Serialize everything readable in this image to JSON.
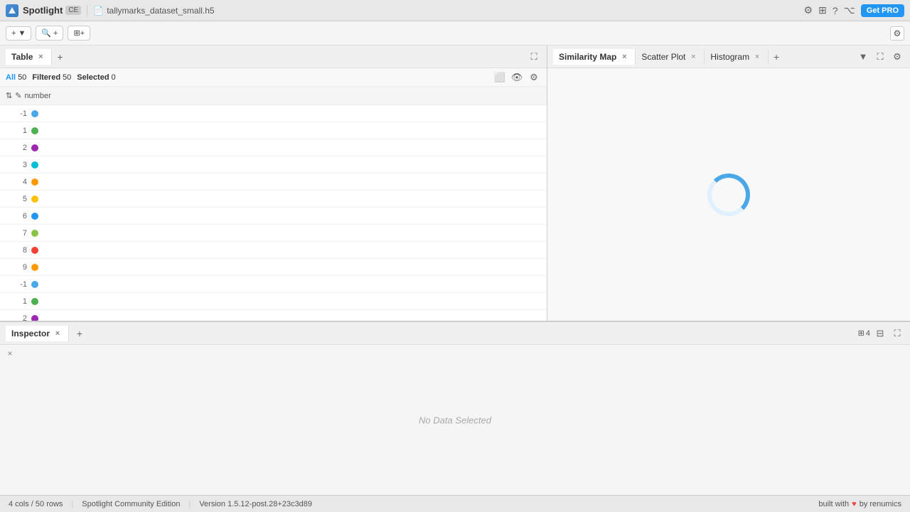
{
  "titlebar": {
    "title": "Spotlight",
    "ce_badge": "CE",
    "file_icon": "📄",
    "filename": "tallymarks_dataset_small.h5",
    "get_pro": "Get PRO"
  },
  "toolbar": {
    "add_filter_label": "+ ▼",
    "search_label": "🔍+",
    "add_col_label": "⊞+"
  },
  "table_panel": {
    "tab_label": "Table",
    "tab_close": "×",
    "add_tab": "+",
    "all_label": "All",
    "all_count": "50",
    "filtered_label": "Filtered",
    "filtered_count": "50",
    "selected_label": "Selected",
    "selected_count": "0",
    "col_name": "number"
  },
  "right_panel": {
    "tabs": [
      {
        "label": "Similarity Map",
        "active": true,
        "closable": true
      },
      {
        "label": "Scatter Plot",
        "active": false,
        "closable": true
      },
      {
        "label": "Histogram",
        "active": false,
        "closable": true
      }
    ],
    "add_tab": "+"
  },
  "table_rows": [
    {
      "num": "-1",
      "color": "#4aa8e8"
    },
    {
      "num": "1",
      "color": "#4caf50"
    },
    {
      "num": "2",
      "color": "#9c27b0"
    },
    {
      "num": "3",
      "color": "#00bcd4"
    },
    {
      "num": "4",
      "color": "#ff9800"
    },
    {
      "num": "5",
      "color": "#ffc107"
    },
    {
      "num": "6",
      "color": "#2196f3"
    },
    {
      "num": "7",
      "color": "#8bc34a"
    },
    {
      "num": "8",
      "color": "#f44336"
    },
    {
      "num": "9",
      "color": "#ff9800"
    },
    {
      "num": "-1",
      "color": "#4aa8e8"
    },
    {
      "num": "1",
      "color": "#4caf50"
    },
    {
      "num": "2",
      "color": "#9c27b0"
    }
  ],
  "inspector": {
    "tab_label": "Inspector",
    "tab_close": "×",
    "add_tab": "+",
    "no_data_text": "No Data Selected",
    "grid_count": "4",
    "fullscreen_icon": "⛶"
  },
  "statusbar": {
    "left": "4 cols / 50 rows",
    "edition": "Spotlight Community Edition",
    "version": "Version 1.5.12-post.28+23c3d89",
    "built_with": "built with",
    "heart": "♥",
    "by": "by renumics"
  }
}
